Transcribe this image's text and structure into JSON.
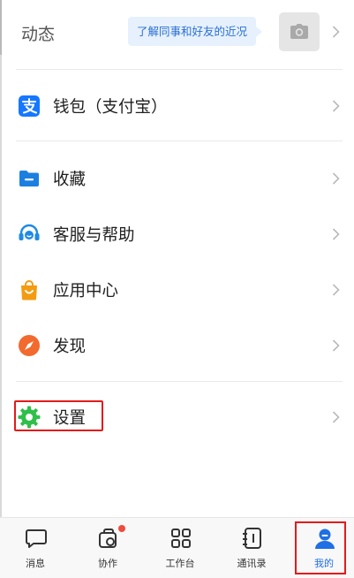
{
  "moments": {
    "label": "动态",
    "bubble_text": "了解同事和好友的近况",
    "camera_icon": "camera-icon"
  },
  "menu": {
    "items": [
      {
        "label": "钱包（支付宝）",
        "icon": "alipay-icon",
        "color": "#1677ff"
      },
      {
        "label": "收藏",
        "icon": "folder-icon",
        "color": "#1c7fe0"
      },
      {
        "label": "客服与帮助",
        "icon": "headset-icon",
        "color": "#1f8ae8"
      },
      {
        "label": "应用中心",
        "icon": "shopping-bag-icon",
        "color": "#f39c12"
      },
      {
        "label": "发现",
        "icon": "compass-icon",
        "color": "#f26a2e"
      },
      {
        "label": "设置",
        "icon": "gear-icon",
        "color": "#2fbf4a"
      }
    ]
  },
  "nav": {
    "items": [
      {
        "label": "消息",
        "icon": "chat-bubble-icon"
      },
      {
        "label": "协作",
        "icon": "collaboration-icon",
        "badge": true
      },
      {
        "label": "工作台",
        "icon": "grid-icon"
      },
      {
        "label": "通讯录",
        "icon": "contacts-book-icon"
      },
      {
        "label": "我的",
        "icon": "profile-icon",
        "active": true
      }
    ],
    "accent": "#1f6fe5"
  },
  "highlight_color": "#e21b1b"
}
